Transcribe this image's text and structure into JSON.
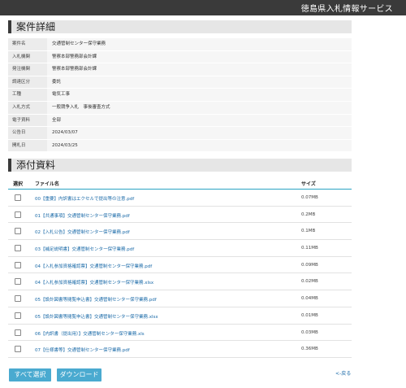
{
  "header": {
    "site_title": "徳島県入札情報サービス"
  },
  "details": {
    "title": "案件詳細",
    "rows": [
      {
        "label": "案件名",
        "value": "交通管制センター保守業務"
      },
      {
        "label": "入札機関",
        "value": "警察本部警務部会計課"
      },
      {
        "label": "発注機関",
        "value": "警察本部警務部会計課"
      },
      {
        "label": "調達区分",
        "value": "委託"
      },
      {
        "label": "工種",
        "value": "電気工事"
      },
      {
        "label": "入札方式",
        "value": "一般競争入札　事後審査方式"
      },
      {
        "label": "電子資料",
        "value": "全部"
      },
      {
        "label": "公告日",
        "value": "2024/03/07"
      },
      {
        "label": "開札日",
        "value": "2024/03/25"
      }
    ]
  },
  "attachments": {
    "title": "添付資料",
    "columns": {
      "select": "選択",
      "filename": "ファイル名",
      "size": "サイズ"
    },
    "files": [
      {
        "name": "00【重要】内訳書はエクセルで提出等の注意.pdf",
        "size": "0.07MB"
      },
      {
        "name": "01【共通事項】交通管制センター保守業務.pdf",
        "size": "0.2MB"
      },
      {
        "name": "02【入札公告】交通管制センター保守業務.pdf",
        "size": "0.1MB"
      },
      {
        "name": "03【補足説明書】交通管制センター保守業務.pdf",
        "size": "0.11MB"
      },
      {
        "name": "04【入札参加資格確認票】交通管制センター保守業務.pdf",
        "size": "0.09MB"
      },
      {
        "name": "04【入札参加資格確認票】交通管制センター保守業務.xlsx",
        "size": "0.02MB"
      },
      {
        "name": "05【設計図書等閲覧申込書】交通管制センター保守業務.pdf",
        "size": "0.04MB"
      },
      {
        "name": "05【設計図書等閲覧申込書】交通管制センター保守業務.xlsx",
        "size": "0.01MB"
      },
      {
        "name": "06【内訳書（提出用）】交通管制センター保守業務.xls",
        "size": "0.03MB"
      },
      {
        "name": "07【仕様書等】交通管制センター保守業務.pdf",
        "size": "0.36MB"
      }
    ]
  },
  "actions": {
    "select_all": "すべて選択",
    "download": "ダウンロード",
    "back": "<-戻る"
  }
}
